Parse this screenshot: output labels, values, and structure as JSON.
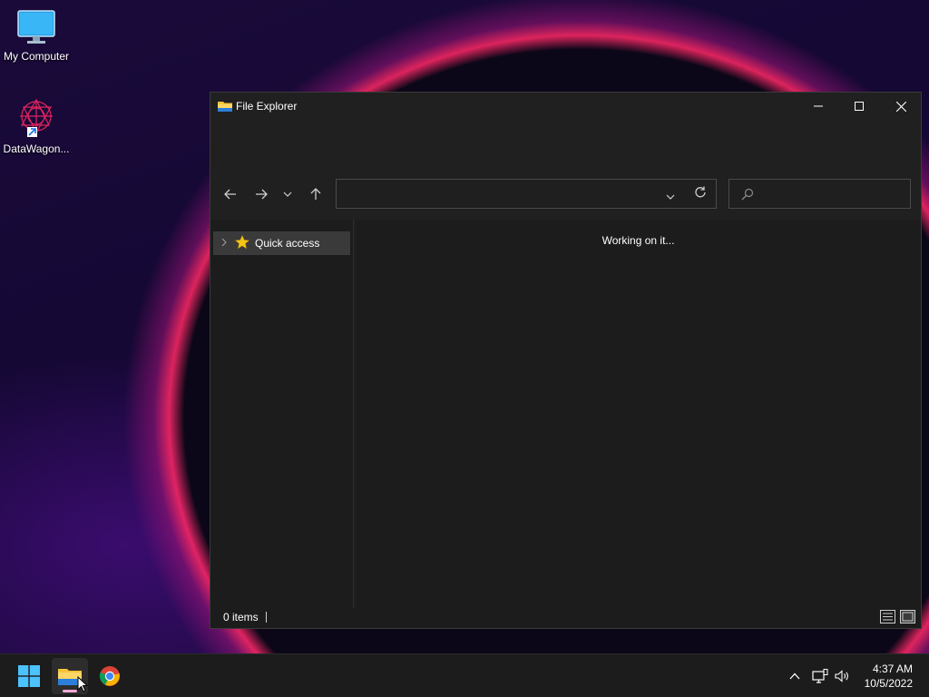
{
  "desktop": {
    "icons": [
      {
        "label": "My Computer",
        "icon": "monitor-icon"
      },
      {
        "label": "DataWagon...",
        "icon": "datawagon-app-icon"
      }
    ]
  },
  "window": {
    "title": "File Explorer",
    "address_value": "",
    "search_placeholder": "",
    "nav_pane": {
      "items": [
        {
          "label": "Quick access",
          "icon": "star-icon",
          "expanded": false
        }
      ]
    },
    "content_message": "Working on it...",
    "status": {
      "item_count": "0 items"
    }
  },
  "taskbar": {
    "apps": [
      {
        "name": "start",
        "icon": "windows-logo-icon"
      },
      {
        "name": "file-explorer",
        "icon": "folder-icon",
        "active": true
      },
      {
        "name": "chrome",
        "icon": "chrome-icon"
      }
    ],
    "clock": {
      "time": "4:37 AM",
      "date": "10/5/2022"
    }
  },
  "colors": {
    "accent": "#0078d4",
    "window_bg": "#202020",
    "pane_bg": "#1c1c1c"
  }
}
